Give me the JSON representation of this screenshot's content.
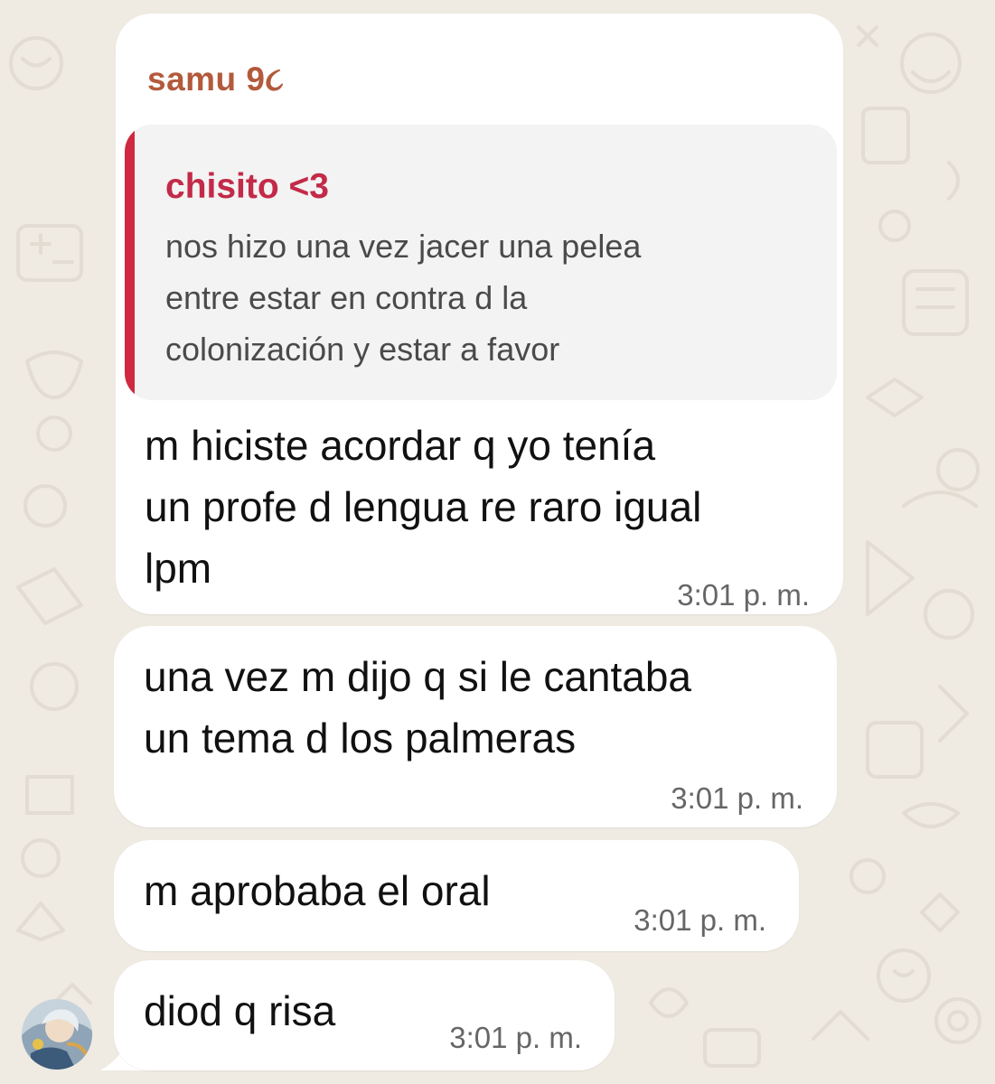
{
  "sender": {
    "name": "samu 9૮"
  },
  "quoted_message": {
    "author": "chisito <3",
    "text_lines": [
      "nos hizo una vez jacer una pelea",
      "entre estar en contra d la",
      "colonización y estar a favor"
    ]
  },
  "messages": [
    {
      "lines": [
        "m hiciste acordar q yo tenía",
        "un profe d lengua re raro igual",
        "lpm"
      ],
      "time": "3:01 p. m."
    },
    {
      "lines": [
        "una vez m dijo q si le cantaba",
        "un tema d los palmeras"
      ],
      "time": "3:01 p. m."
    },
    {
      "lines": [
        "m aprobaba el oral"
      ],
      "time": "3:01 p. m."
    },
    {
      "lines": [
        "diod q risa"
      ],
      "time": "3:01 p. m."
    }
  ],
  "icons": {
    "avatar": "avatar-icon"
  },
  "colors": {
    "background": "#efeae2",
    "bubble": "#ffffff",
    "sender_name": "#b35a3c",
    "quote_bar": "#d0283f",
    "quote_author": "#c32a48",
    "timestamp": "#666666"
  }
}
